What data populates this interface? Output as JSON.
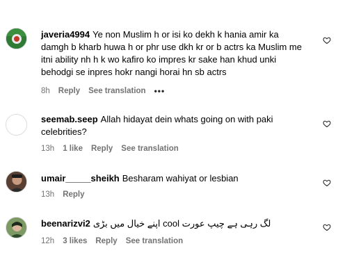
{
  "comments": [
    {
      "username": "javeria4994",
      "text": "Ye non Muslim h or isi ko dekh k hania amir ka damgh b kharb huwa h or phr use dkh kr or b actrs ka Muslim me itni ability nh h k wo kafiro ko impres kr sake han khud unki behodgi se inpres hokr nangi horai hn sb actrs",
      "time": "8h",
      "likes": "",
      "reply_label": "Reply",
      "translation_label": "See translation",
      "more_label": "•••"
    },
    {
      "username": "seemab.seep",
      "text": "Allah hidayat dein whats going on with paki celebrities?",
      "time": "13h",
      "likes": "1 like",
      "reply_label": "Reply",
      "translation_label": "See translation"
    },
    {
      "username": "umair_____sheikh",
      "text": "Besharam wahiyat or lesbian",
      "time": "13h",
      "reply_label": "Reply"
    },
    {
      "username": "beenarizvi2",
      "text": "اپنے خیال میں بڑی cool لگ رہی ہے چیپ عورت",
      "time": "12h",
      "likes": "3 likes",
      "reply_label": "Reply",
      "translation_label": "See translation"
    }
  ],
  "icons": {
    "like": "heart-outline-icon",
    "more": "more-options-icon"
  },
  "colors": {
    "text": "#000000",
    "meta": "#737373",
    "border": "#dbdbdb"
  }
}
